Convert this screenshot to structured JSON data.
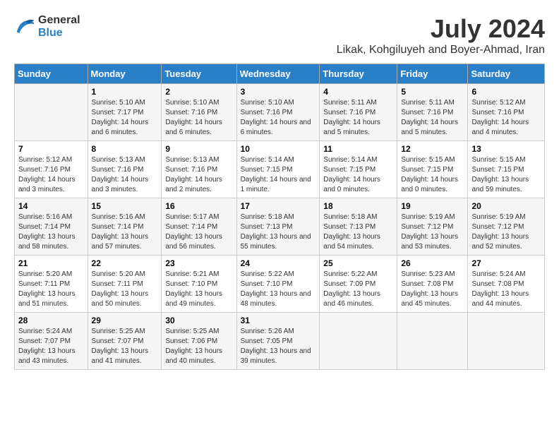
{
  "header": {
    "logo_line1": "General",
    "logo_line2": "Blue",
    "month": "July 2024",
    "location": "Likak, Kohgiluyeh and Boyer-Ahmad, Iran"
  },
  "weekdays": [
    "Sunday",
    "Monday",
    "Tuesday",
    "Wednesday",
    "Thursday",
    "Friday",
    "Saturday"
  ],
  "weeks": [
    [
      {
        "day": "",
        "sunrise": "",
        "sunset": "",
        "daylight": ""
      },
      {
        "day": "1",
        "sunrise": "Sunrise: 5:10 AM",
        "sunset": "Sunset: 7:17 PM",
        "daylight": "Daylight: 14 hours and 6 minutes."
      },
      {
        "day": "2",
        "sunrise": "Sunrise: 5:10 AM",
        "sunset": "Sunset: 7:16 PM",
        "daylight": "Daylight: 14 hours and 6 minutes."
      },
      {
        "day": "3",
        "sunrise": "Sunrise: 5:10 AM",
        "sunset": "Sunset: 7:16 PM",
        "daylight": "Daylight: 14 hours and 6 minutes."
      },
      {
        "day": "4",
        "sunrise": "Sunrise: 5:11 AM",
        "sunset": "Sunset: 7:16 PM",
        "daylight": "Daylight: 14 hours and 5 minutes."
      },
      {
        "day": "5",
        "sunrise": "Sunrise: 5:11 AM",
        "sunset": "Sunset: 7:16 PM",
        "daylight": "Daylight: 14 hours and 5 minutes."
      },
      {
        "day": "6",
        "sunrise": "Sunrise: 5:12 AM",
        "sunset": "Sunset: 7:16 PM",
        "daylight": "Daylight: 14 hours and 4 minutes."
      }
    ],
    [
      {
        "day": "7",
        "sunrise": "Sunrise: 5:12 AM",
        "sunset": "Sunset: 7:16 PM",
        "daylight": "Daylight: 14 hours and 3 minutes."
      },
      {
        "day": "8",
        "sunrise": "Sunrise: 5:13 AM",
        "sunset": "Sunset: 7:16 PM",
        "daylight": "Daylight: 14 hours and 3 minutes."
      },
      {
        "day": "9",
        "sunrise": "Sunrise: 5:13 AM",
        "sunset": "Sunset: 7:16 PM",
        "daylight": "Daylight: 14 hours and 2 minutes."
      },
      {
        "day": "10",
        "sunrise": "Sunrise: 5:14 AM",
        "sunset": "Sunset: 7:15 PM",
        "daylight": "Daylight: 14 hours and 1 minute."
      },
      {
        "day": "11",
        "sunrise": "Sunrise: 5:14 AM",
        "sunset": "Sunset: 7:15 PM",
        "daylight": "Daylight: 14 hours and 0 minutes."
      },
      {
        "day": "12",
        "sunrise": "Sunrise: 5:15 AM",
        "sunset": "Sunset: 7:15 PM",
        "daylight": "Daylight: 14 hours and 0 minutes."
      },
      {
        "day": "13",
        "sunrise": "Sunrise: 5:15 AM",
        "sunset": "Sunset: 7:15 PM",
        "daylight": "Daylight: 13 hours and 59 minutes."
      }
    ],
    [
      {
        "day": "14",
        "sunrise": "Sunrise: 5:16 AM",
        "sunset": "Sunset: 7:14 PM",
        "daylight": "Daylight: 13 hours and 58 minutes."
      },
      {
        "day": "15",
        "sunrise": "Sunrise: 5:16 AM",
        "sunset": "Sunset: 7:14 PM",
        "daylight": "Daylight: 13 hours and 57 minutes."
      },
      {
        "day": "16",
        "sunrise": "Sunrise: 5:17 AM",
        "sunset": "Sunset: 7:14 PM",
        "daylight": "Daylight: 13 hours and 56 minutes."
      },
      {
        "day": "17",
        "sunrise": "Sunrise: 5:18 AM",
        "sunset": "Sunset: 7:13 PM",
        "daylight": "Daylight: 13 hours and 55 minutes."
      },
      {
        "day": "18",
        "sunrise": "Sunrise: 5:18 AM",
        "sunset": "Sunset: 7:13 PM",
        "daylight": "Daylight: 13 hours and 54 minutes."
      },
      {
        "day": "19",
        "sunrise": "Sunrise: 5:19 AM",
        "sunset": "Sunset: 7:12 PM",
        "daylight": "Daylight: 13 hours and 53 minutes."
      },
      {
        "day": "20",
        "sunrise": "Sunrise: 5:19 AM",
        "sunset": "Sunset: 7:12 PM",
        "daylight": "Daylight: 13 hours and 52 minutes."
      }
    ],
    [
      {
        "day": "21",
        "sunrise": "Sunrise: 5:20 AM",
        "sunset": "Sunset: 7:11 PM",
        "daylight": "Daylight: 13 hours and 51 minutes."
      },
      {
        "day": "22",
        "sunrise": "Sunrise: 5:20 AM",
        "sunset": "Sunset: 7:11 PM",
        "daylight": "Daylight: 13 hours and 50 minutes."
      },
      {
        "day": "23",
        "sunrise": "Sunrise: 5:21 AM",
        "sunset": "Sunset: 7:10 PM",
        "daylight": "Daylight: 13 hours and 49 minutes."
      },
      {
        "day": "24",
        "sunrise": "Sunrise: 5:22 AM",
        "sunset": "Sunset: 7:10 PM",
        "daylight": "Daylight: 13 hours and 48 minutes."
      },
      {
        "day": "25",
        "sunrise": "Sunrise: 5:22 AM",
        "sunset": "Sunset: 7:09 PM",
        "daylight": "Daylight: 13 hours and 46 minutes."
      },
      {
        "day": "26",
        "sunrise": "Sunrise: 5:23 AM",
        "sunset": "Sunset: 7:08 PM",
        "daylight": "Daylight: 13 hours and 45 minutes."
      },
      {
        "day": "27",
        "sunrise": "Sunrise: 5:24 AM",
        "sunset": "Sunset: 7:08 PM",
        "daylight": "Daylight: 13 hours and 44 minutes."
      }
    ],
    [
      {
        "day": "28",
        "sunrise": "Sunrise: 5:24 AM",
        "sunset": "Sunset: 7:07 PM",
        "daylight": "Daylight: 13 hours and 43 minutes."
      },
      {
        "day": "29",
        "sunrise": "Sunrise: 5:25 AM",
        "sunset": "Sunset: 7:07 PM",
        "daylight": "Daylight: 13 hours and 41 minutes."
      },
      {
        "day": "30",
        "sunrise": "Sunrise: 5:25 AM",
        "sunset": "Sunset: 7:06 PM",
        "daylight": "Daylight: 13 hours and 40 minutes."
      },
      {
        "day": "31",
        "sunrise": "Sunrise: 5:26 AM",
        "sunset": "Sunset: 7:05 PM",
        "daylight": "Daylight: 13 hours and 39 minutes."
      },
      {
        "day": "",
        "sunrise": "",
        "sunset": "",
        "daylight": ""
      },
      {
        "day": "",
        "sunrise": "",
        "sunset": "",
        "daylight": ""
      },
      {
        "day": "",
        "sunrise": "",
        "sunset": "",
        "daylight": ""
      }
    ]
  ]
}
